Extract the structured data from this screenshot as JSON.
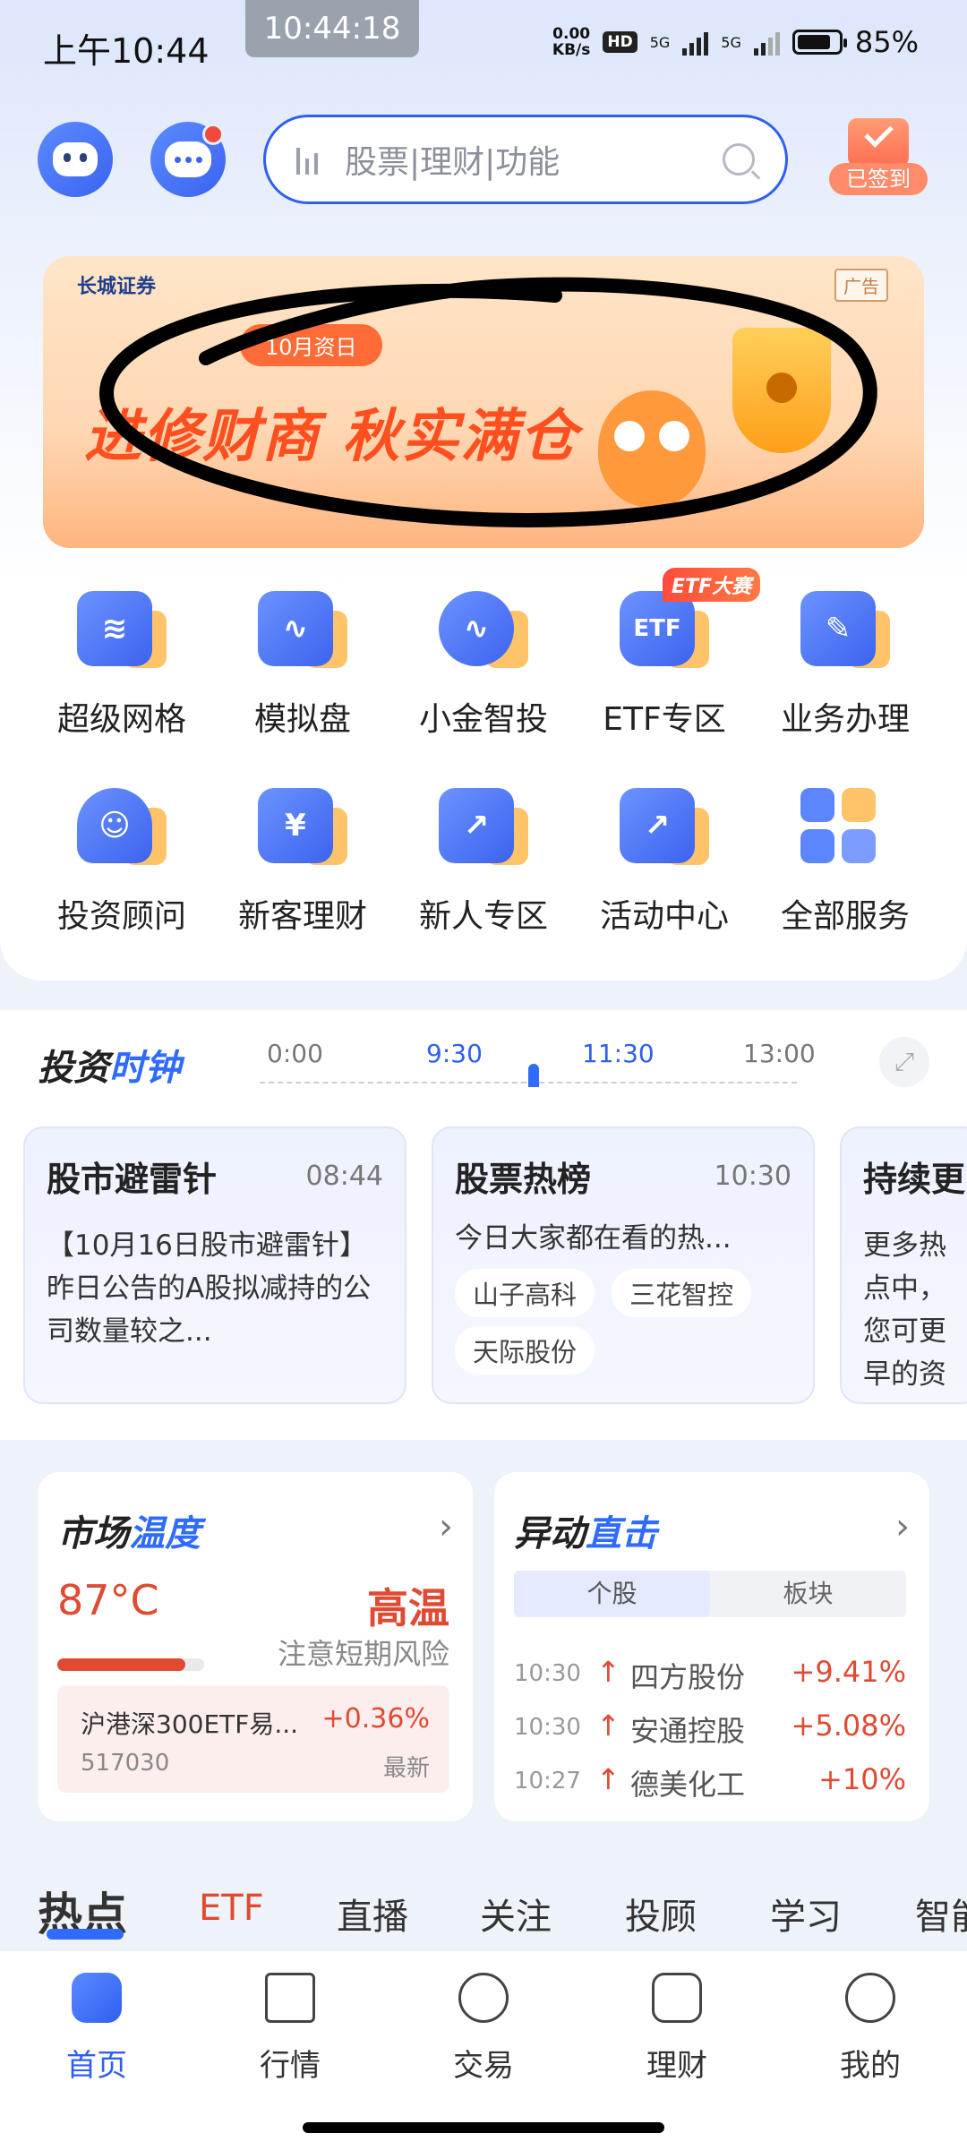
{
  "status_bar": {
    "time": "上午10:44",
    "center_time": "10:44:18",
    "net_speed_value": "0.00",
    "net_speed_unit": "KB/s",
    "hd_label": "HD",
    "network_1": "5G",
    "network_2": "5G",
    "battery": "85%",
    "battery_level": 0.85
  },
  "header": {
    "search_placeholder": "股票|理财|功能",
    "checkin_label": "已签到"
  },
  "banner": {
    "brand": "长城证券",
    "ad_tag": "广告",
    "pill": "10月资日",
    "title": "进修财商 秋实满仓"
  },
  "services": [
    {
      "label": "超级网格",
      "icon": "grid-trading-icon"
    },
    {
      "label": "模拟盘",
      "icon": "simulation-icon"
    },
    {
      "label": "小金智投",
      "icon": "smart-invest-icon"
    },
    {
      "label": "ETF专区",
      "icon": "etf-icon"
    },
    {
      "label": "业务办理",
      "icon": "business-icon"
    },
    {
      "label": "投资顾问",
      "icon": "advisor-icon"
    },
    {
      "label": "新客理财",
      "icon": "new-client-finance-icon"
    },
    {
      "label": "新人专区",
      "icon": "newcomer-icon"
    },
    {
      "label": "活动中心",
      "icon": "activity-center-icon"
    },
    {
      "label": "全部服务",
      "icon": "all-services-icon"
    }
  ],
  "etf_badge": "ETF大赛",
  "clock": {
    "title_part1": "投资",
    "title_part2": "时钟",
    "times": [
      "0:00",
      "9:30",
      "11:30",
      "13:00"
    ]
  },
  "cards": [
    {
      "title": "股市避雷针",
      "time": "08:44",
      "body": "【10月16日股市避雷针】昨日公告的A股拟减持的公司数量较之..."
    },
    {
      "title": "股票热榜",
      "time": "10:30",
      "body": "今日大家都在看的热...",
      "chips": [
        "山子高科",
        "三花智控",
        "天际股份"
      ]
    },
    {
      "title": "持续更",
      "body": "更多热点中，您可更早的资"
    }
  ],
  "market_temp": {
    "title_part1": "市场",
    "title_part2": "温度",
    "value": "87°C",
    "status": "高温",
    "note": "注意短期风险",
    "level": 0.87,
    "etf_name": "沪港深300ETF易...",
    "etf_change": "+0.36%",
    "etf_code": "517030",
    "etf_latest": "最新"
  },
  "movers": {
    "title_part1": "异动",
    "title_part2": "直击",
    "tabs": [
      "个股",
      "板块"
    ],
    "items": [
      {
        "time": "10:30",
        "name": "四方股份",
        "change": "+9.41%"
      },
      {
        "time": "10:30",
        "name": "安通控股",
        "change": "+5.08%"
      },
      {
        "time": "10:27",
        "name": "德美化工",
        "change": "+10%"
      }
    ]
  },
  "category_tabs": [
    "热点",
    "ETF",
    "直播",
    "关注",
    "投顾",
    "学习",
    "智能"
  ],
  "bottom_nav": [
    {
      "label": "首页"
    },
    {
      "label": "行情"
    },
    {
      "label": "交易"
    },
    {
      "label": "理财"
    },
    {
      "label": "我的"
    }
  ],
  "colors": {
    "accent": "#2f5ff0",
    "up": "#e04a33"
  }
}
